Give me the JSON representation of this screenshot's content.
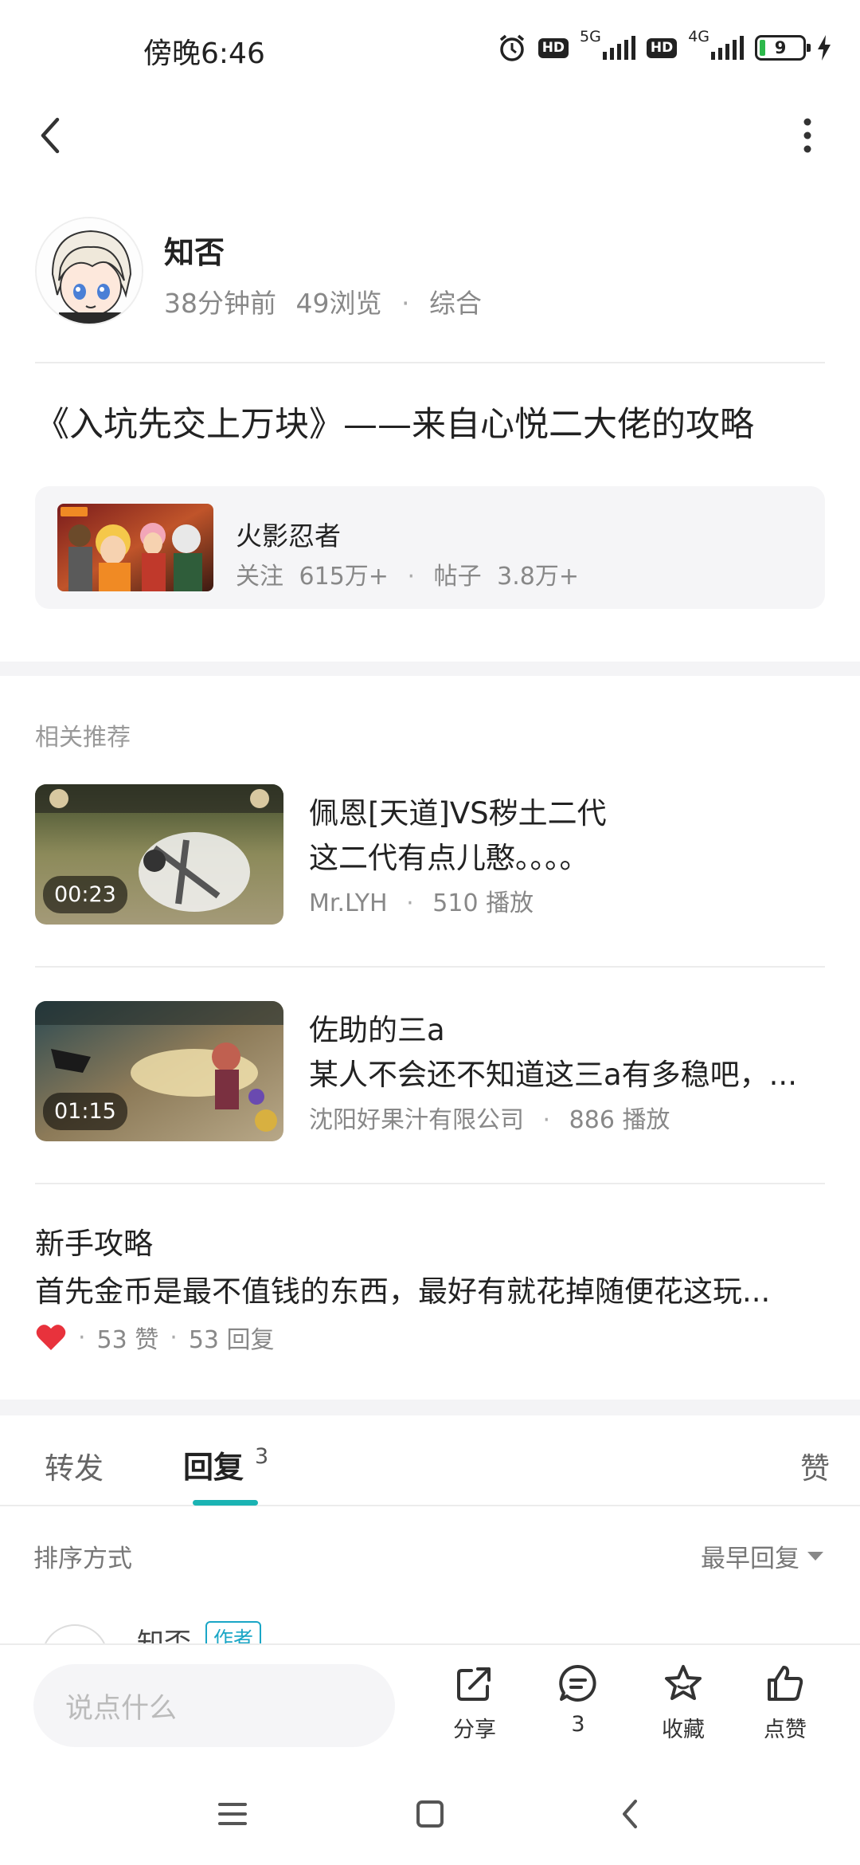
{
  "status_bar": {
    "time": "傍晚6:46",
    "net_5g": "5G",
    "net_4g": "4G",
    "hd": "HD",
    "battery": "9"
  },
  "author": {
    "name": "知否",
    "time_ago": "38分钟前",
    "views": "49浏览",
    "category": "综合"
  },
  "post": {
    "title": "《入坑先交上万块》——来自心悦二大佬的攻略"
  },
  "game_card": {
    "name": "火影忍者",
    "followers_label": "关注",
    "followers": "615万+",
    "posts_label": "帖子",
    "posts": "3.8万+"
  },
  "related": {
    "label": "相关推荐",
    "videos": [
      {
        "title": "佩恩[天道]VS秽土二代",
        "subtitle": "这二代有点儿憨。。。。",
        "author": "Mr.LYH",
        "plays": "510 播放",
        "duration": "00:23"
      },
      {
        "title": "佐助的三a",
        "subtitle": "某人不会还不知道这三a有多稳吧，...",
        "author": "沈阳好果汁有限公司",
        "plays": "886 播放",
        "duration": "01:15"
      }
    ],
    "guide": {
      "title": "新手攻略",
      "text": "首先金币是最不值钱的东西，最好有就花掉随便花这玩...",
      "likes": "53 赞",
      "replies": "53 回复"
    }
  },
  "tabs": {
    "repost": "转发",
    "reply": "回复",
    "reply_count": "3",
    "like": "赞"
  },
  "sort": {
    "label": "排序方式",
    "value": "最早回复"
  },
  "comment_peek": {
    "name": "知否",
    "tag": "作者"
  },
  "bottom_bar": {
    "input_placeholder": "说点什么",
    "share": "分享",
    "comments": "3",
    "favorite": "收藏",
    "like": "点赞"
  },
  "colors": {
    "accent": "#1ab3b3",
    "heart": "#e8323c",
    "tag": "#1aa6c6"
  }
}
